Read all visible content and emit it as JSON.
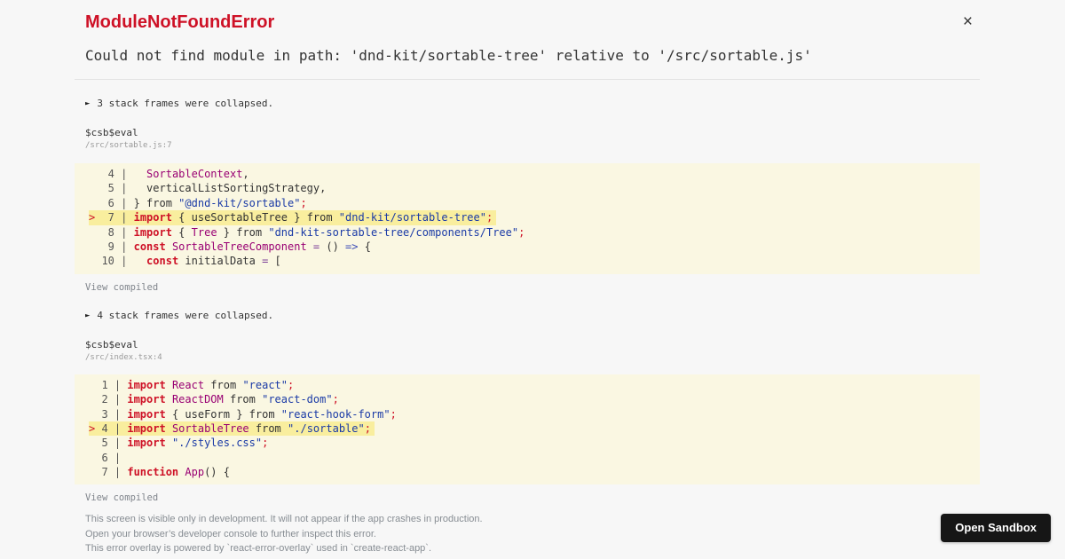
{
  "header": {
    "title": "ModuleNotFoundError",
    "message": "Could not find module in path: 'dnd-kit/sortable-tree' relative to '/src/sortable.js'",
    "close_label": "×"
  },
  "sections": [
    {
      "collapse_icon": "►",
      "collapse_text": "3 stack frames were collapsed.",
      "frame_name": "$csb$eval",
      "frame_location": "/src/sortable.js:7",
      "view_compiled": "View compiled"
    },
    {
      "collapse_icon": "►",
      "collapse_text": "4 stack frames were collapsed.",
      "frame_name": "$csb$eval",
      "frame_location": "/src/index.tsx:4",
      "view_compiled": "View compiled"
    }
  ],
  "code_blocks": [
    {
      "gutter_width": 2,
      "lines": [
        {
          "num": 4,
          "hl": false,
          "tokens": [
            [
              "plain",
              "  "
            ],
            [
              "cap",
              "SortableContext"
            ],
            [
              "plain",
              ","
            ]
          ]
        },
        {
          "num": 5,
          "hl": false,
          "tokens": [
            [
              "plain",
              "  verticalListSortingStrategy,"
            ]
          ]
        },
        {
          "num": 6,
          "hl": false,
          "tokens": [
            [
              "plain",
              "} from "
            ],
            [
              "str",
              "\"@dnd-kit/sortable\""
            ],
            [
              "semi",
              ";"
            ]
          ]
        },
        {
          "num": 7,
          "hl": true,
          "tokens": [
            [
              "kw",
              "import"
            ],
            [
              "plain",
              " { useSortableTree } from "
            ],
            [
              "str",
              "\"dnd-kit/sortable-tree\""
            ],
            [
              "semi",
              ";"
            ]
          ]
        },
        {
          "num": 8,
          "hl": false,
          "tokens": [
            [
              "kw",
              "import"
            ],
            [
              "plain",
              " { "
            ],
            [
              "cap",
              "Tree"
            ],
            [
              "plain",
              " } from "
            ],
            [
              "str",
              "\"dnd-kit-sortable-tree/components/Tree\""
            ],
            [
              "semi",
              ";"
            ]
          ]
        },
        {
          "num": 9,
          "hl": false,
          "tokens": [
            [
              "kw",
              "const"
            ],
            [
              "plain",
              " "
            ],
            [
              "cap",
              "SortableTreeComponent"
            ],
            [
              "plain",
              " "
            ],
            [
              "op",
              "="
            ],
            [
              "plain",
              " () "
            ],
            [
              "arrow",
              "=>"
            ],
            [
              "plain",
              " {"
            ]
          ]
        },
        {
          "num": 10,
          "hl": false,
          "tokens": [
            [
              "plain",
              "  "
            ],
            [
              "kw",
              "const"
            ],
            [
              "plain",
              " initialData "
            ],
            [
              "op",
              "="
            ],
            [
              "plain",
              " ["
            ]
          ]
        }
      ]
    },
    {
      "gutter_width": 1,
      "lines": [
        {
          "num": 1,
          "hl": false,
          "tokens": [
            [
              "kw",
              "import"
            ],
            [
              "plain",
              " "
            ],
            [
              "cap",
              "React"
            ],
            [
              "plain",
              " from "
            ],
            [
              "str",
              "\"react\""
            ],
            [
              "semi",
              ";"
            ]
          ]
        },
        {
          "num": 2,
          "hl": false,
          "tokens": [
            [
              "kw",
              "import"
            ],
            [
              "plain",
              " "
            ],
            [
              "cap",
              "ReactDOM"
            ],
            [
              "plain",
              " from "
            ],
            [
              "str",
              "\"react-dom\""
            ],
            [
              "semi",
              ";"
            ]
          ]
        },
        {
          "num": 3,
          "hl": false,
          "tokens": [
            [
              "kw",
              "import"
            ],
            [
              "plain",
              " { useForm } from "
            ],
            [
              "str",
              "\"react-hook-form\""
            ],
            [
              "semi",
              ";"
            ]
          ]
        },
        {
          "num": 4,
          "hl": true,
          "tokens": [
            [
              "kw",
              "import"
            ],
            [
              "plain",
              " "
            ],
            [
              "cap",
              "SortableTree"
            ],
            [
              "plain",
              " from "
            ],
            [
              "str",
              "\"./sortable\""
            ],
            [
              "semi",
              ";"
            ]
          ]
        },
        {
          "num": 5,
          "hl": false,
          "tokens": [
            [
              "kw",
              "import"
            ],
            [
              "plain",
              " "
            ],
            [
              "str",
              "\"./styles.css\""
            ],
            [
              "semi",
              ";"
            ]
          ]
        },
        {
          "num": 6,
          "hl": false,
          "tokens": []
        },
        {
          "num": 7,
          "hl": false,
          "tokens": [
            [
              "kw",
              "function"
            ],
            [
              "plain",
              " "
            ],
            [
              "cap",
              "App"
            ],
            [
              "plain",
              "() {"
            ]
          ]
        }
      ]
    }
  ],
  "footer": {
    "lines": [
      "This screen is visible only in development. It will not appear if the app crashes in production.",
      "Open your browser’s developer console to further inspect this error.",
      "This error overlay is powered by `react-error-overlay` used in `create-react-app`."
    ]
  },
  "open_sandbox_label": "Open Sandbox",
  "colors": {
    "error_red": "#ce1126",
    "keyword_red": "#ce1126",
    "identifier_magenta": "#990073",
    "string_blue": "#1a3aa6",
    "code_background": "#faf7e2",
    "highlight_background": "#f9ee9e",
    "page_background": "#f7f7f7",
    "button_background": "#161616"
  }
}
